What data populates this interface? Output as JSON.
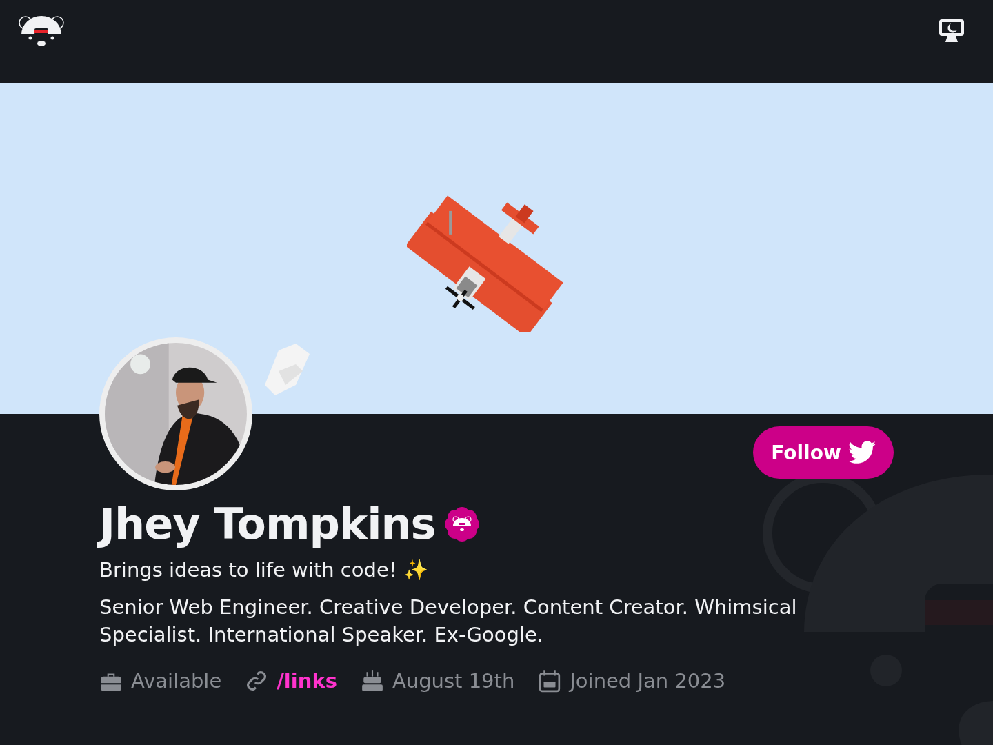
{
  "header": {
    "dark_mode": true
  },
  "profile": {
    "name": "Jhey Tompkins",
    "verified": true,
    "tagline": "Brings ideas to life with code! ✨",
    "bio": "Senior Web Engineer. Creative Developer. Content Creator. Whimsical Specialist. International Speaker. Ex-Google.",
    "follow_button": "Follow",
    "meta": [
      {
        "kind": "status",
        "text": "Available"
      },
      {
        "kind": "link",
        "text": "/links"
      },
      {
        "kind": "birthday",
        "text": "August 19th"
      },
      {
        "kind": "joined",
        "text": "Joined Jan 2023"
      }
    ]
  }
}
